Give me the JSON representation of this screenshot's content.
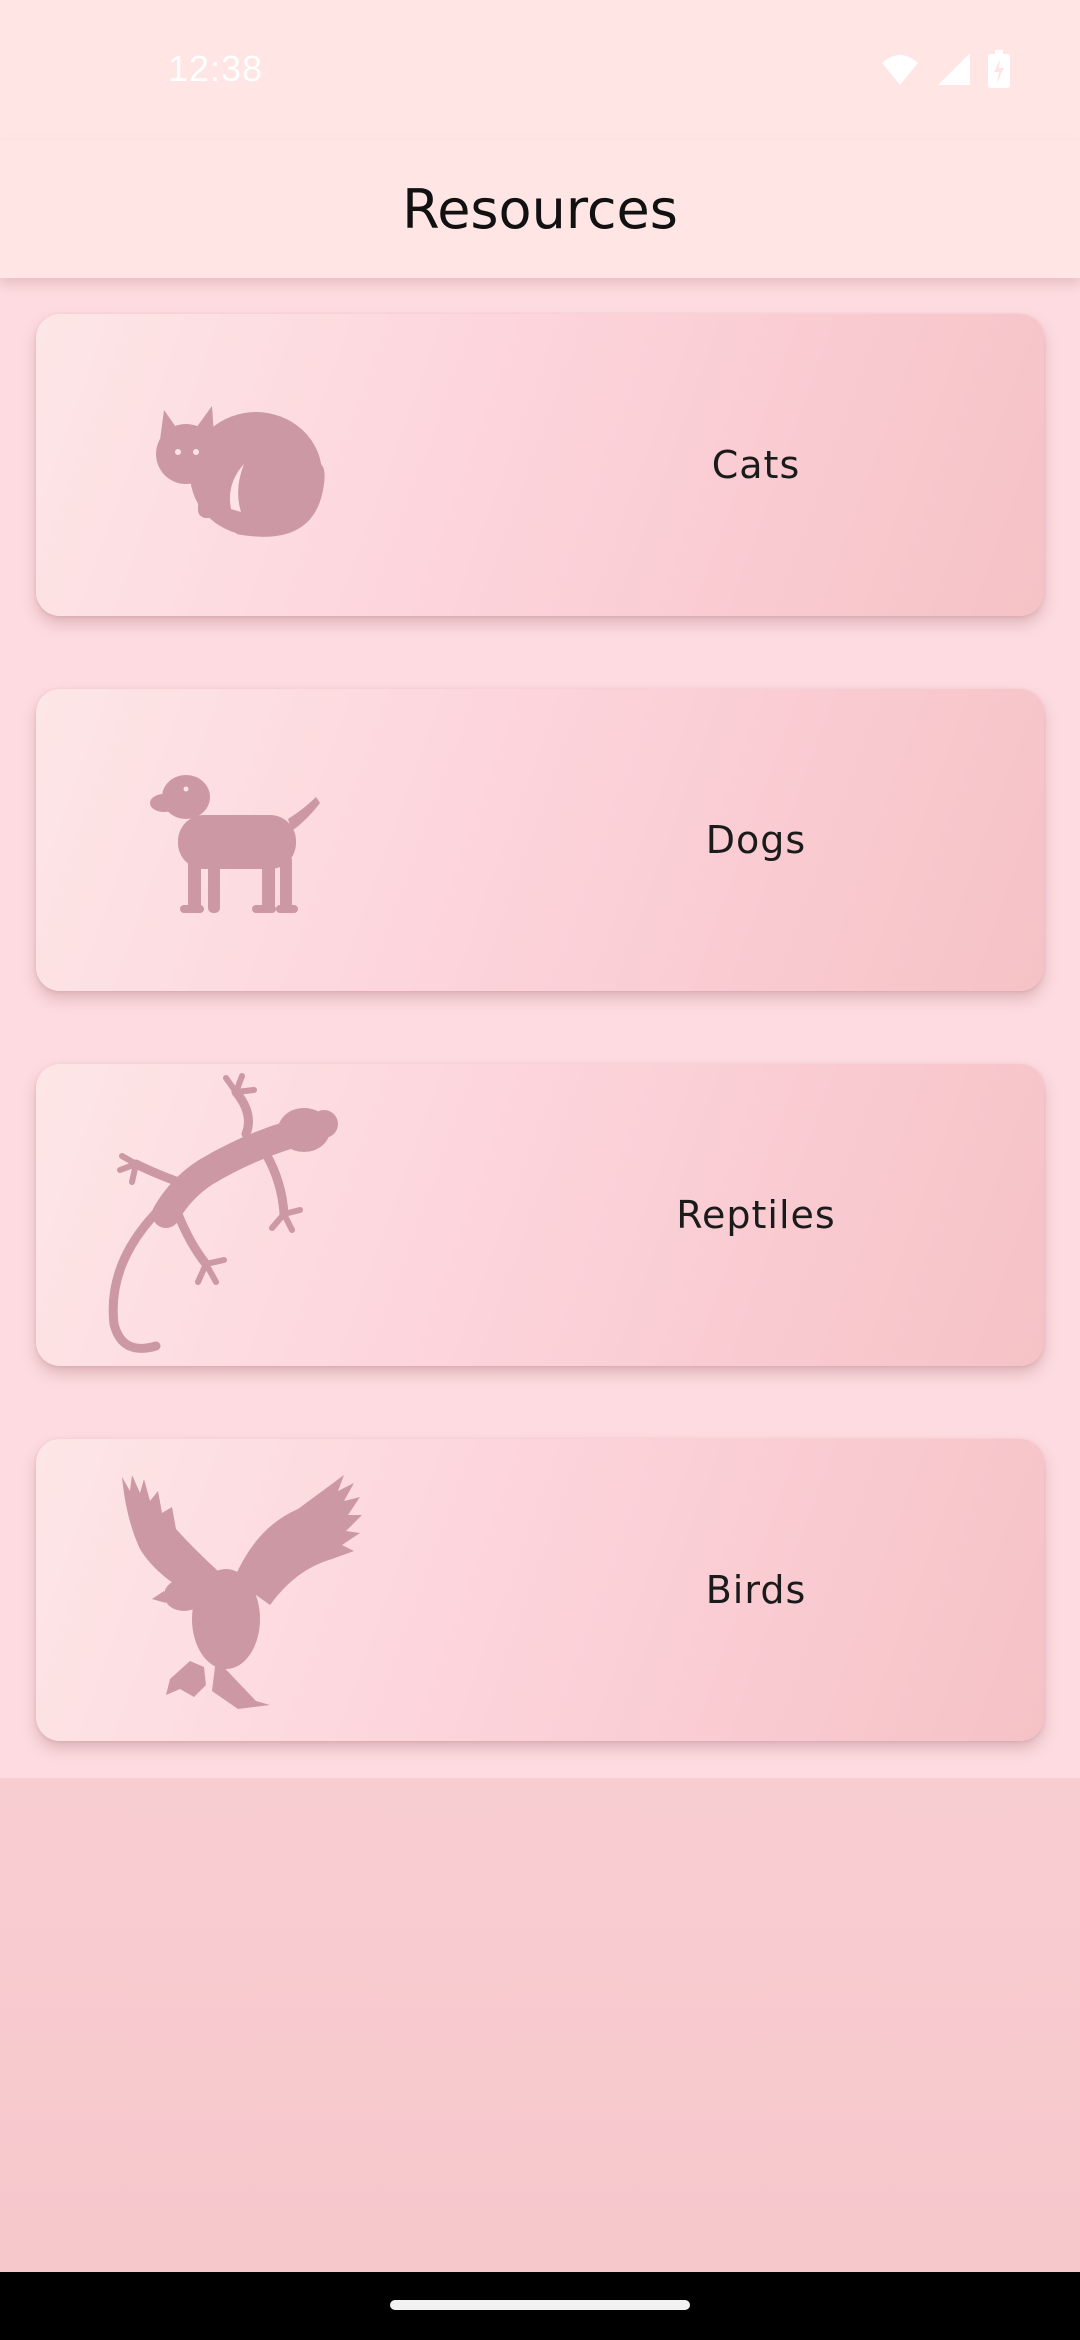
{
  "status_bar": {
    "time": "12:38",
    "icons": [
      "wifi-icon",
      "cellular-signal-icon",
      "battery-charging-icon"
    ]
  },
  "app_bar": {
    "title": "Resources"
  },
  "categories": [
    {
      "label": "Cats",
      "icon": "cat-icon"
    },
    {
      "label": "Dogs",
      "icon": "dog-icon"
    },
    {
      "label": "Reptiles",
      "icon": "lizard-icon"
    },
    {
      "label": "Birds",
      "icon": "eagle-icon"
    }
  ],
  "colors": {
    "icon_fill": "#cc98a3",
    "app_bar_bg": "#ffe5e4",
    "card_gradient_start": "#fde6e7",
    "card_gradient_end": "#f5c2c6"
  }
}
